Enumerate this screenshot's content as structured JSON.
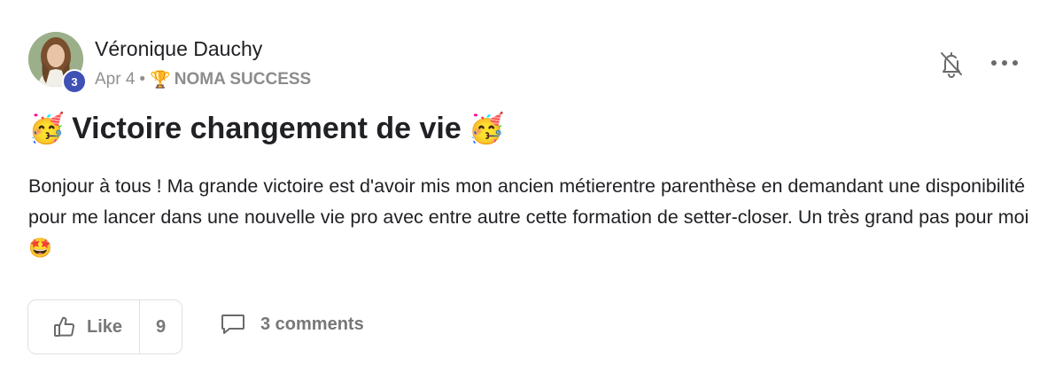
{
  "author": {
    "name": "Véronique Dauchy",
    "level": "3",
    "avatar_icon": "user-avatar-photo"
  },
  "meta": {
    "date": "Apr 4",
    "separator": "•",
    "category_icon": "🏆",
    "category": "NOMA SUCCESS"
  },
  "post": {
    "title_emoji": "🥳",
    "title": "Victoire changement de vie",
    "body": "Bonjour à tous ! Ma grande victoire est d'avoir mis mon ancien métierentre parenthèse en demandant une disponibilité pour me lancer dans une nouvelle vie pro avec entre autre cette formation de setter-closer. Un très grand pas pour moi 🤩"
  },
  "actions": {
    "like_label": "Like",
    "like_count": "9",
    "comments_label": "3 comments"
  },
  "icons": {
    "bell": "bell-off-icon",
    "more": "more-horizontal-icon",
    "like": "thumbs-up-icon",
    "comment": "comment-icon"
  },
  "colors": {
    "badge": "#3f51b5",
    "muted": "#909090",
    "text": "#202124"
  }
}
